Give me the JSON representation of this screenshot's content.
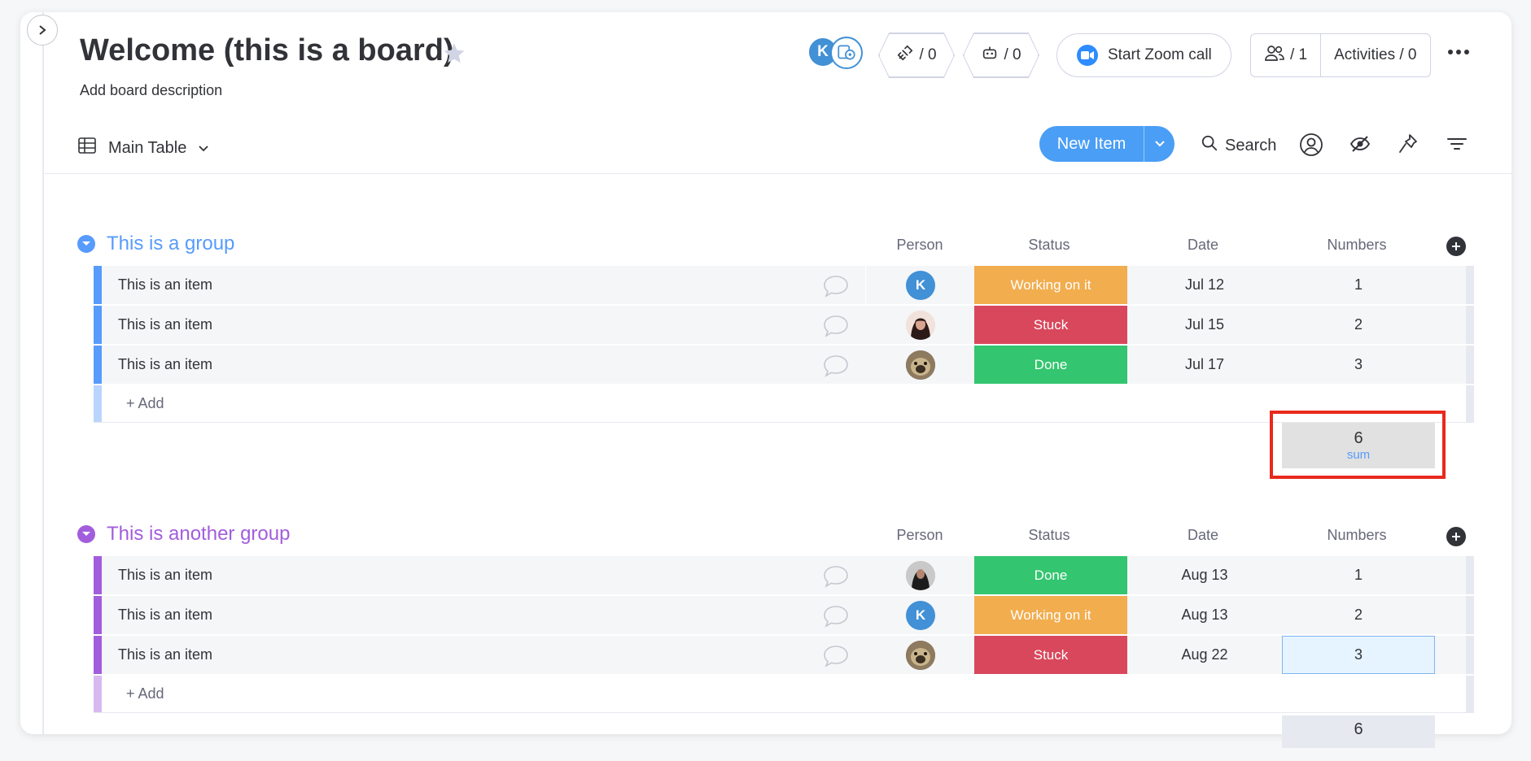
{
  "board": {
    "title": "Welcome (this is a board)",
    "description": "Add board description"
  },
  "header": {
    "avatar_initial": "K",
    "integrations_count": "/ 0",
    "automations_count": "/ 0",
    "zoom_label": "Start Zoom call",
    "members_count": "/ 1",
    "activities_label": "Activities / 0"
  },
  "toolbar": {
    "view_label": "Main Table",
    "new_item_label": "New Item",
    "search_label": "Search"
  },
  "columns": {
    "person": "Person",
    "status": "Status",
    "date": "Date",
    "numbers": "Numbers"
  },
  "colors": {
    "group1": "#579bfc",
    "group2": "#a25ddc",
    "working": "#fdab3d",
    "stuck": "#e2445c",
    "done": "#00c875",
    "highlight": "#e8291c"
  },
  "groups": [
    {
      "title": "This is a group",
      "add_label": "+ Add",
      "sum_value": "6",
      "sum_label": "sum",
      "items": [
        {
          "name": "This is an item",
          "person": "K",
          "status": "Working on it",
          "date": "Jul 12",
          "number": "1"
        },
        {
          "name": "This is an item",
          "person": "photo",
          "status": "Stuck",
          "date": "Jul 15",
          "number": "2"
        },
        {
          "name": "This is an item",
          "person": "dog",
          "status": "Done",
          "date": "Jul 17",
          "number": "3"
        }
      ]
    },
    {
      "title": "This is another group",
      "add_label": "+ Add",
      "sum_value": "6",
      "items": [
        {
          "name": "This is an item",
          "person": "photo2",
          "status": "Done",
          "date": "Aug 13",
          "number": "1"
        },
        {
          "name": "This is an item",
          "person": "K",
          "status": "Working on it",
          "date": "Aug 13",
          "number": "2"
        },
        {
          "name": "This is an item",
          "person": "dog",
          "status": "Stuck",
          "date": "Aug 22",
          "number": "3"
        }
      ]
    }
  ]
}
